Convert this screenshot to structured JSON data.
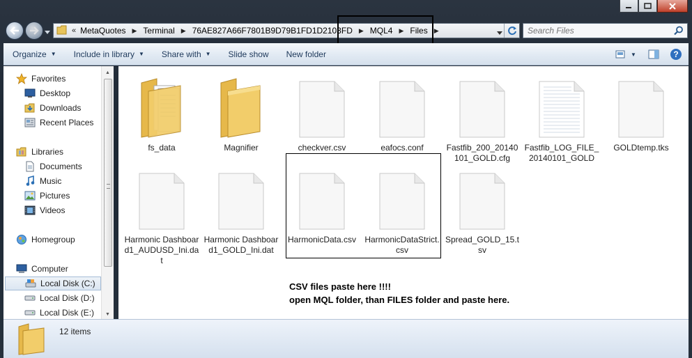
{
  "window": {
    "address": {
      "lead": "«",
      "crumbs": [
        "MetaQuotes",
        "Terminal",
        "76AE827A66F7801B9D79B1FD1D2103FD",
        "MQL4",
        "Files"
      ]
    },
    "search_placeholder": "Search Files"
  },
  "toolbar": {
    "organize": "Organize",
    "include": "Include in library",
    "share": "Share with",
    "slideshow": "Slide show",
    "newfolder": "New folder"
  },
  "nav": {
    "favorites": "Favorites",
    "desktop": "Desktop",
    "downloads": "Downloads",
    "recent": "Recent Places",
    "libraries": "Libraries",
    "documents": "Documents",
    "music": "Music",
    "pictures": "Pictures",
    "videos": "Videos",
    "homegroup": "Homegroup",
    "computer": "Computer",
    "disk_c": "Local Disk (C:)",
    "disk_d": "Local Disk (D:)",
    "disk_e": "Local Disk (E:)"
  },
  "files": [
    {
      "name": "fs_data",
      "type": "folder-docs"
    },
    {
      "name": "Magnifier",
      "type": "folder"
    },
    {
      "name": "checkver.csv",
      "type": "file"
    },
    {
      "name": "eafocs.conf",
      "type": "file"
    },
    {
      "name": "Fastfib_200_20140101_GOLD.cfg",
      "type": "file"
    },
    {
      "name": "Fastfib_LOG_FILE_20140101_GOLD",
      "type": "text"
    },
    {
      "name": "GOLDtemp.tks",
      "type": "file"
    },
    {
      "name": "Harmonic Dashboard1_AUDUSD_Ini.dat",
      "type": "file"
    },
    {
      "name": "Harmonic Dashboard1_GOLD_Ini.dat",
      "type": "file"
    },
    {
      "name": "HarmonicData.csv",
      "type": "file"
    },
    {
      "name": "HarmonicDataStrict.csv",
      "type": "file"
    },
    {
      "name": "Spread_GOLD_15.tsv",
      "type": "file"
    }
  ],
  "annotation": {
    "line1": "CSV files paste here !!!!",
    "line2": "open MQL folder, than FILES folder and paste here."
  },
  "status": {
    "count": "12 items"
  }
}
